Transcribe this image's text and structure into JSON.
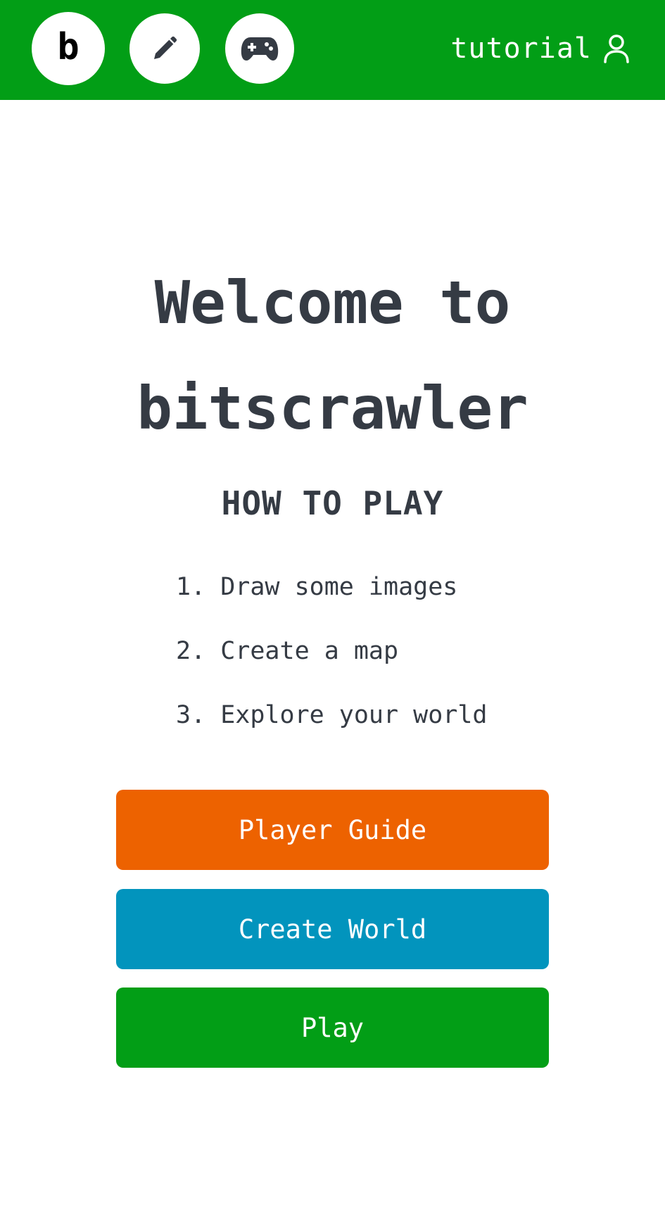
{
  "header": {
    "logo_letter": "b",
    "user_label": "tutorial"
  },
  "icons": {
    "logo": "bitscrawler-logo-icon",
    "draw": "pencil-icon",
    "play": "gamepad-icon",
    "user": "user-icon"
  },
  "main": {
    "title_line1": "Welcome to",
    "title_line2": "bitscrawler",
    "how_to_heading": "HOW TO PLAY",
    "steps": [
      "1. Draw some images",
      "2. Create a map",
      "3. Explore your world"
    ]
  },
  "buttons": {
    "guide": "Player Guide",
    "create": "Create World",
    "play": "Play"
  },
  "colors": {
    "header_green": "#029e16",
    "guide_orange": "#ed6200",
    "create_blue": "#0294bd",
    "play_green": "#029e16",
    "text_dark": "#353b44"
  }
}
